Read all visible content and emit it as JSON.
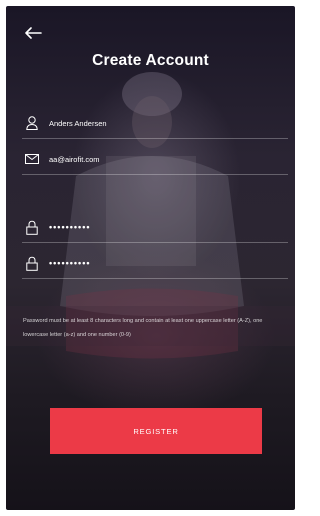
{
  "header": {
    "back_icon": "arrow-left-icon",
    "title": "Create Account"
  },
  "form": {
    "name": {
      "icon": "user-icon",
      "value": "Anders Andersen"
    },
    "email": {
      "icon": "mail-icon",
      "value": "aa@airofit.com"
    },
    "password": {
      "icon": "lock-icon",
      "value": "••••••••••"
    },
    "confirm_password": {
      "icon": "lock-icon",
      "value": "••••••••••"
    }
  },
  "hint": "Password must be at least 8 characters long and contain at least one uppercase letter (A-Z), one lowercase letter (a-z) and one number (0-9)",
  "register_label": "REGISTER",
  "colors": {
    "accent": "#ec3a47",
    "text": "#ffffff"
  }
}
